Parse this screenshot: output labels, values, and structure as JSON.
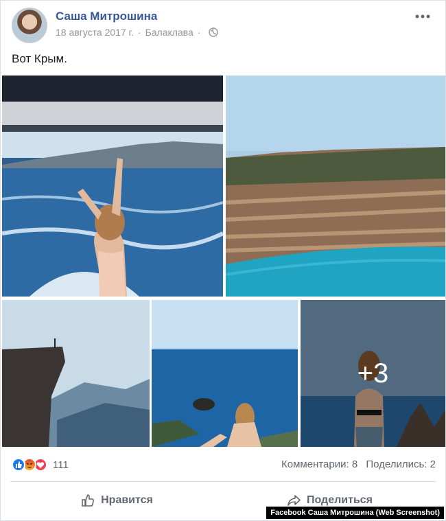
{
  "post": {
    "author": "Саша Митрошина",
    "date": "18 августа 2017 г.",
    "separator": "·",
    "location": "Балаклава",
    "text": "Вот Крым.",
    "privacy_icon": "globe-icon",
    "menu_icon": "more-dots-icon"
  },
  "gallery": {
    "extra_count_label": "+3",
    "photos": [
      {
        "name": "photo-boat-wake"
      },
      {
        "name": "photo-quarry-lake"
      },
      {
        "name": "photo-cliff"
      },
      {
        "name": "photo-sea-rock"
      },
      {
        "name": "photo-more"
      }
    ]
  },
  "reactions": {
    "icons": [
      "like-reaction-icon",
      "angry-reaction-icon",
      "love-reaction-icon"
    ],
    "count": "111",
    "comments": "Комментарии: 8",
    "shares": "Поделились: 2"
  },
  "actions": {
    "like_label": "Нравится",
    "share_label": "Поделиться"
  },
  "watermark": "Facebook Саша Митрошина (Web Screenshot)",
  "colors": {
    "author_link": "#385898",
    "secondary_text": "#90949c",
    "action_text": "#606770",
    "like_blue": "#1877f2",
    "love_red": "#f33e58"
  }
}
